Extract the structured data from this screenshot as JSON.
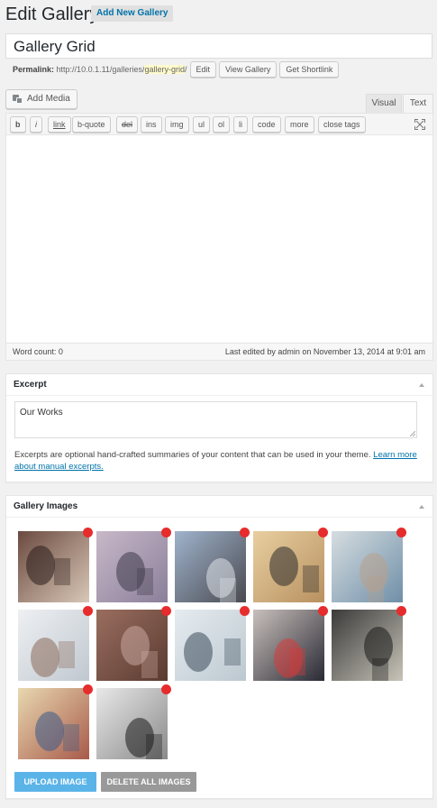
{
  "header": {
    "title": "Edit Gallery",
    "add_new_label": "Add New Gallery"
  },
  "post_title": "Gallery Grid",
  "permalink": {
    "label": "Permalink:",
    "base": "http://10.0.1.11/galleries/",
    "slug": "gallery-grid",
    "trailing": "/",
    "edit_label": "Edit",
    "view_label": "View Gallery",
    "shortlink_label": "Get Shortlink"
  },
  "editor": {
    "add_media_label": "Add Media",
    "tab_visual": "Visual",
    "tab_text": "Text",
    "quicktags": [
      "b",
      "i",
      "link",
      "b-quote",
      "del",
      "ins",
      "img",
      "ul",
      "ol",
      "li",
      "code",
      "more",
      "close tags"
    ],
    "content": "",
    "word_count": "Word count: 0",
    "last_edited": "Last edited by admin on November 13, 2014 at 9:01 am"
  },
  "excerpt": {
    "title": "Excerpt",
    "value": "Our Works",
    "help_text": "Excerpts are optional hand-crafted summaries of your content that can be used in your theme. ",
    "help_link": "Learn more about manual excerpts."
  },
  "gallery": {
    "title": "Gallery Images",
    "images": [
      {
        "subject": "friends-in-car",
        "palette": [
          "#6b4a3f",
          "#d8c7b8",
          "#2a1e1a"
        ]
      },
      {
        "subject": "couple-lying-on-road",
        "palette": [
          "#c8b8c8",
          "#8a7f9a",
          "#3e3a4a"
        ]
      },
      {
        "subject": "stone-archway",
        "palette": [
          "#9fb3cc",
          "#4a4a50",
          "#e0e4ea"
        ]
      },
      {
        "subject": "bicycle-on-wall",
        "palette": [
          "#e8cfa0",
          "#b89060",
          "#2a2a2a"
        ]
      },
      {
        "subject": "couple-embracing",
        "palette": [
          "#d6dde0",
          "#6f8fa8",
          "#b8a08c"
        ]
      },
      {
        "subject": "girl-in-winter-hat",
        "palette": [
          "#eef0f2",
          "#c0c8d0",
          "#8a6a5a"
        ]
      },
      {
        "subject": "bare-branches",
        "palette": [
          "#9a6e60",
          "#5a3a30",
          "#c8a8a0"
        ]
      },
      {
        "subject": "person-in-snow-forest",
        "palette": [
          "#e6ecf0",
          "#bcc8d0",
          "#3a4a5a"
        ]
      },
      {
        "subject": "girl-with-scarf",
        "palette": [
          "#c9c0bc",
          "#2a2a35",
          "#d83a3a"
        ]
      },
      {
        "subject": "dark-tree-stump",
        "palette": [
          "#3a3a3a",
          "#c8c4b8",
          "#1a1a1a"
        ]
      },
      {
        "subject": "couple-with-bouquet",
        "palette": [
          "#e8d8b0",
          "#a85a4a",
          "#3a5a8a"
        ]
      },
      {
        "subject": "band-walking-street",
        "palette": [
          "#e8e8e8",
          "#8a8a8a",
          "#1a1a1a"
        ]
      }
    ],
    "upload_label": "UPLOAD IMAGE",
    "delete_all_label": "DELETE ALL IMAGES"
  },
  "colors": {
    "accent": "#0073aa",
    "remove_dot": "#e62c2c",
    "upload_button": "#5bb4e8",
    "delete_button": "#999999"
  }
}
